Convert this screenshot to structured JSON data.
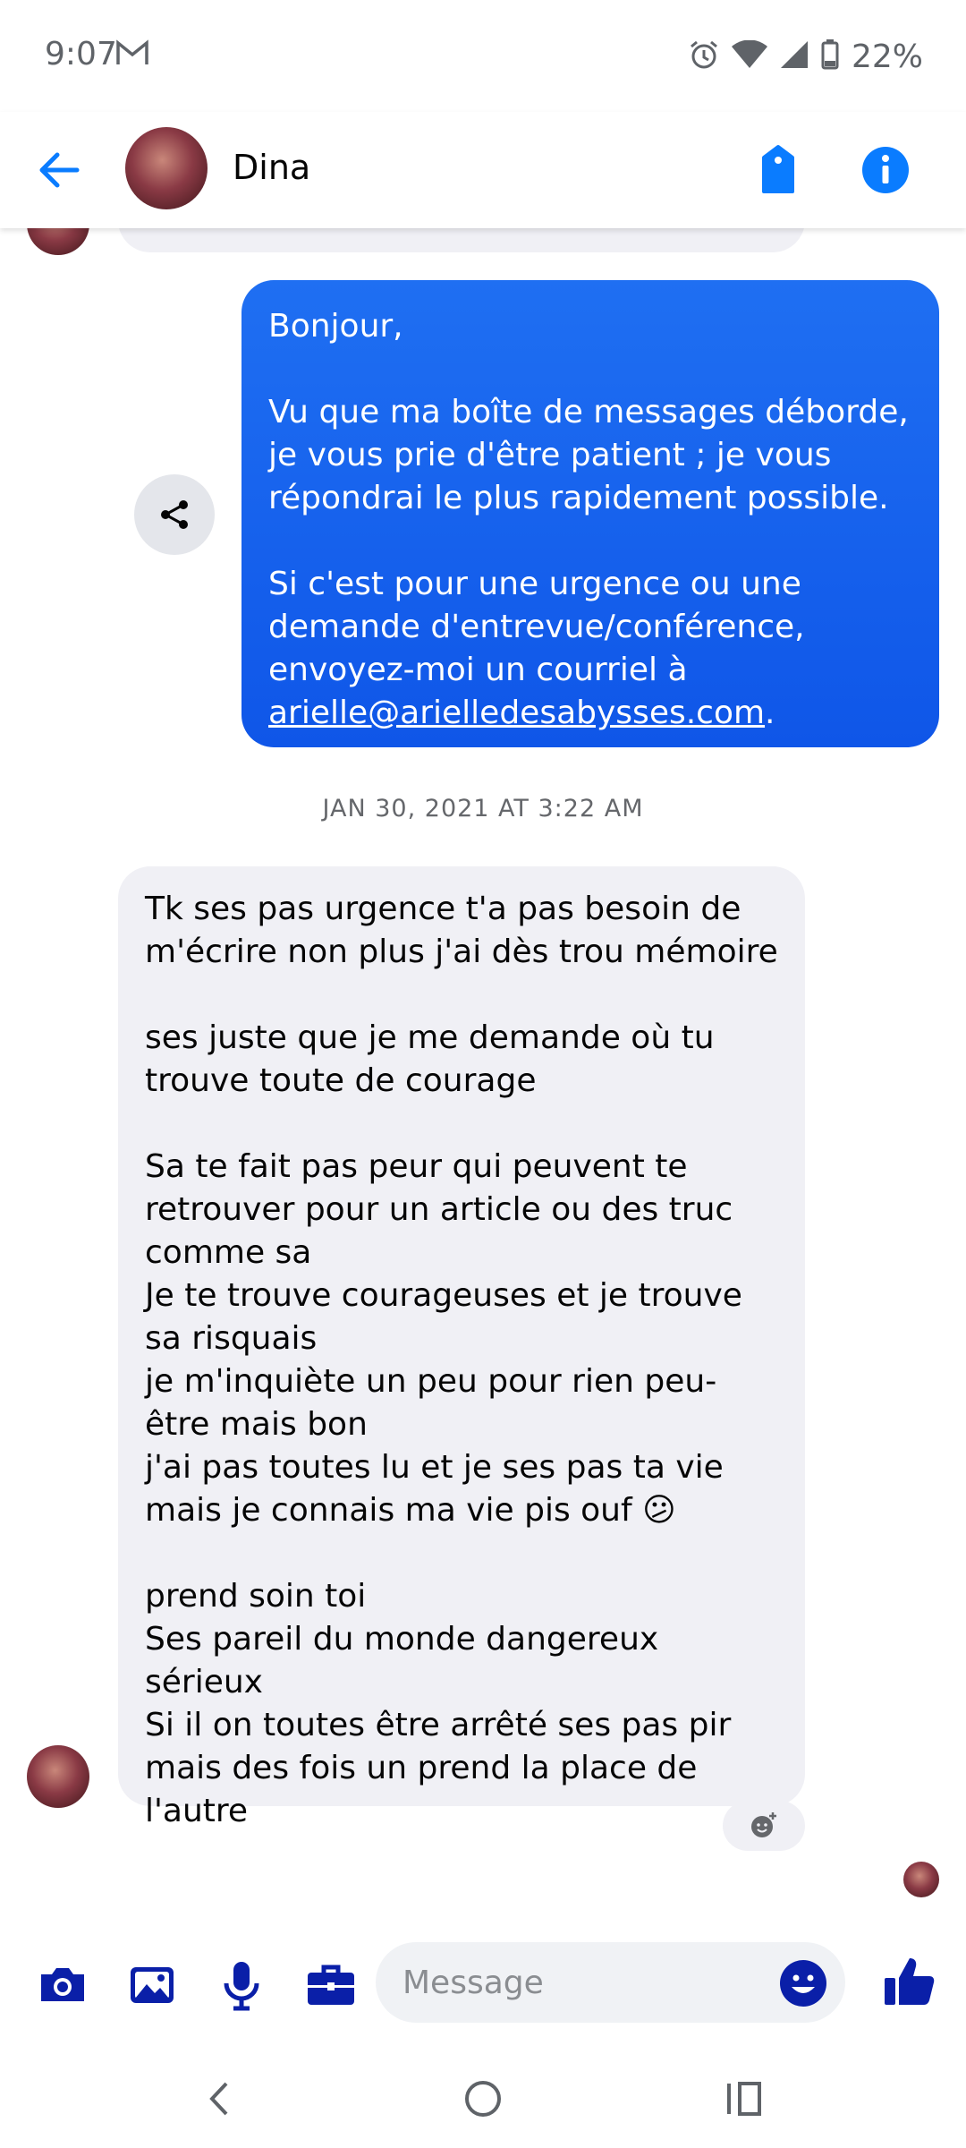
{
  "status_bar": {
    "time": "9:07",
    "battery": "22%"
  },
  "header": {
    "contact_name": "Dina"
  },
  "messages": {
    "outgoing_text": "Bonjour,\n\nVu que ma boîte de messages déborde, je vous prie d'être patient ; je vous répondrai le plus rapidement possible.\n\nSi c'est pour une urgence ou une demande d'entrevue/conférence, envoyez-moi un courriel à ",
    "outgoing_email": "arielle@arielledesabysses.com",
    "outgoing_end": ".",
    "timestamp": "JAN 30, 2021 AT 3:22 AM",
    "incoming_text": "Tk ses pas urgence t'a pas besoin de m'écrire non plus j'ai dès trou mémoire\n\nses juste que je me demande où tu trouve toute de courage\n\nSa te fait pas peur qui peuvent   te retrouver pour un article ou des truc comme sa\nJe te trouve courageuses et  je trouve sa risquais\nje m'inquiète un peu pour rien peu-être mais bon\nj'ai pas toutes lu et je ses pas ta vie mais je connais ma vie pis ouf",
    "incoming_emoji": "😕",
    "incoming_text_2": "\n\nprend soin toi\nSes pareil du monde dangereux sérieux\nSi il on toutes être arrêté ses pas pir mais des fois un prend la place de l'autre"
  },
  "composer": {
    "placeholder": "Message"
  },
  "colors": {
    "accent": "#0a7cff",
    "icon_dark_blue": "#0a1fa8",
    "bubble_out": "#1565f0",
    "bubble_in": "#f0f0f5"
  },
  "icons": {
    "status": [
      "gmail-icon",
      "alarm-icon",
      "wifi-icon",
      "signal-icon",
      "battery-icon"
    ],
    "header": [
      "back-arrow-icon",
      "tag-icon",
      "info-icon"
    ],
    "composer": [
      "camera-icon",
      "gallery-icon",
      "microphone-icon",
      "briefcase-icon",
      "emoji-icon",
      "thumbs-up-icon"
    ],
    "nav": [
      "nav-back-icon",
      "nav-home-icon",
      "nav-recents-icon"
    ]
  }
}
